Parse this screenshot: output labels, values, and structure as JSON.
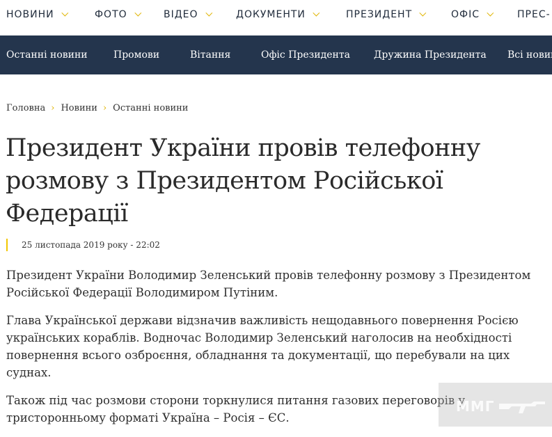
{
  "top_nav": [
    "НОВИНИ",
    "ФОТО",
    "ВІДЕО",
    "ДОКУМЕНТИ",
    "ПРЕЗИДЕНТ",
    "ОФІС",
    "ПРЕС-"
  ],
  "sub_nav": [
    "Останні новини",
    "Промови",
    "Вітання",
    "Офіс Президента",
    "Дружина Президента",
    "Всі новин"
  ],
  "breadcrumbs": [
    "Головна",
    "Новини",
    "Останні новини"
  ],
  "article": {
    "title": "Президент України провів телефонну розмову з Президентом Російської Федерації",
    "date": "25 листопада 2019 року - 22:02",
    "paragraphs": [
      "Президент України Володимир Зеленський провів телефонну розмову з Президентом Російської Федерації Володимиром Путіним.",
      "Глава Української держави відзначив важливість нещодавнього повернення Росією українських кораблів. Водночас Володимир Зеленський наголосив на необхідності повернення всього озброєння, обладнання та документації, що перебували на цих суднах.",
      "Також під час розмови сторони торкнулися питання газових переговорів у тристоронньому форматі Україна – Росія – ЄС."
    ]
  },
  "watermark": {
    "text": "ММГ"
  },
  "colors": {
    "accent": "#f2c700",
    "subnav_bg": "#24354d"
  }
}
